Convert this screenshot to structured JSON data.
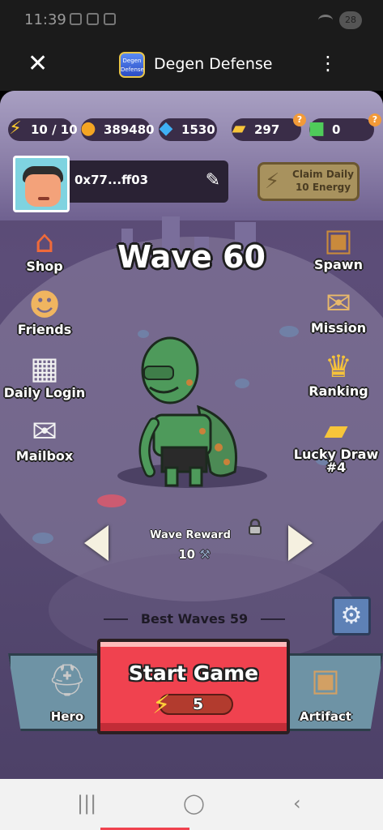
{
  "status_bar": {
    "time": "11:39",
    "battery": "28"
  },
  "app_bar": {
    "title": "Degen Defense",
    "logo_text": "Degen Defense",
    "close_icon": "close-icon",
    "menu_icon": "more-vert-icon"
  },
  "resources": {
    "energy": "10 / 10",
    "gold": "389480",
    "diamond": "1530",
    "ticket": "297",
    "gem": "0"
  },
  "profile": {
    "address": "0x77...ff03"
  },
  "claim": {
    "line1": "Claim Daily",
    "line2": "10 Energy"
  },
  "left_menu": [
    {
      "label": "Shop",
      "icon": "shop-icon"
    },
    {
      "label": "Friends",
      "icon": "friends-icon"
    },
    {
      "label": "Daily Login",
      "icon": "calendar-icon"
    },
    {
      "label": "Mailbox",
      "icon": "mail-icon"
    }
  ],
  "right_menu": [
    {
      "label": "Spawn",
      "icon": "chest-icon"
    },
    {
      "label": "Mission",
      "icon": "mission-icon"
    },
    {
      "label": "Ranking",
      "icon": "ranking-icon"
    },
    {
      "label": "Lucky Draw",
      "label2": "#4",
      "icon": "ticket-icon"
    }
  ],
  "wave": {
    "title": "Wave 60",
    "reward_label": "Wave Reward",
    "reward_value": "10"
  },
  "best_waves": "Best Waves 59",
  "bottom": {
    "hero": "Hero",
    "start": "Start Game",
    "start_cost": "5",
    "artifact": "Artifact"
  },
  "colors": {
    "start_button": "#f0424f",
    "side_panel": "#6e93a5",
    "settings": "#5e81b6",
    "claim_button": "#a8925e"
  }
}
